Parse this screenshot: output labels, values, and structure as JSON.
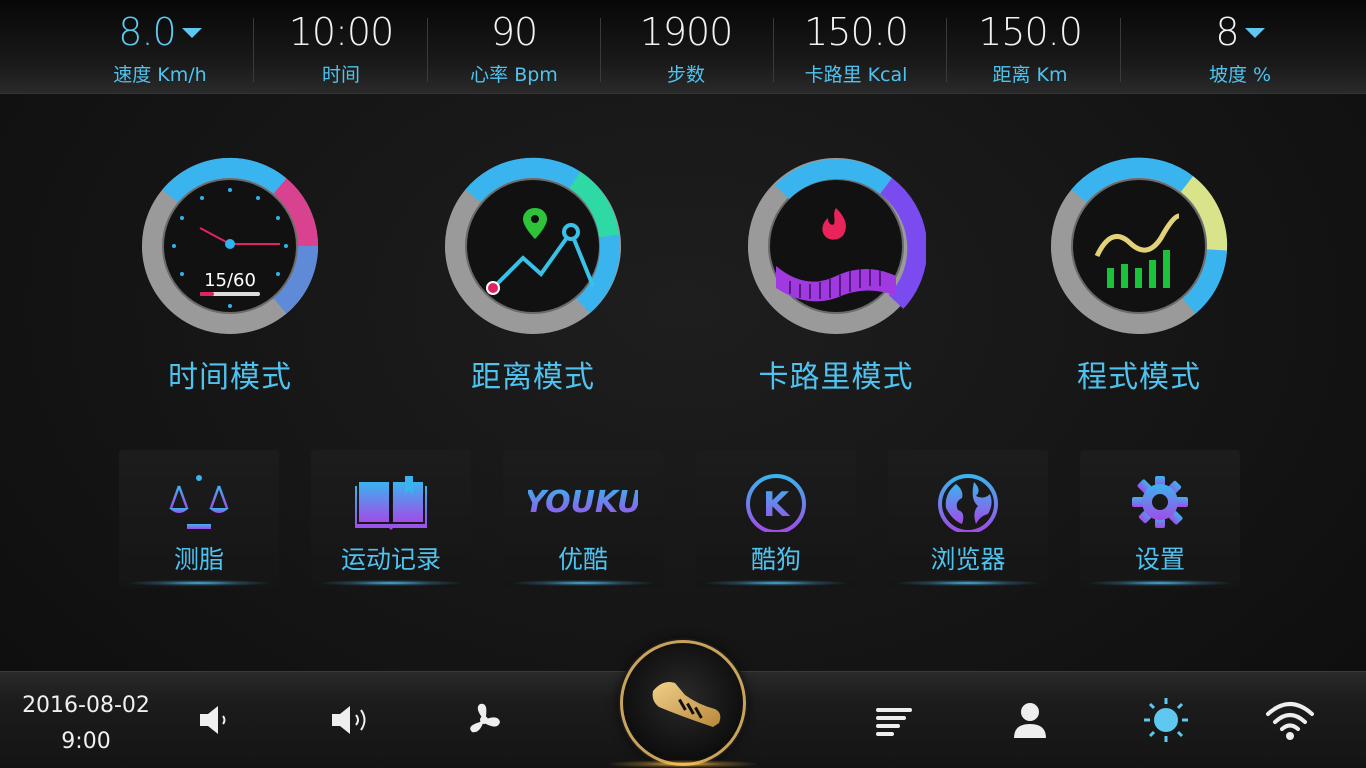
{
  "stats": [
    {
      "value": "8.0",
      "label": "速度 Km/h",
      "dropdown": true
    },
    {
      "value": "10:00",
      "label": "时间"
    },
    {
      "value": "90",
      "label": "心率 Bpm"
    },
    {
      "value": "1900",
      "label": "步数"
    },
    {
      "value": "150.0",
      "label": "卡路里 Kcal"
    },
    {
      "value": "150.0",
      "label": "距离 Km"
    },
    {
      "value": "8",
      "label": "坡度 %",
      "dropdown": true
    }
  ],
  "modes": [
    {
      "label": "时间模式",
      "icon": "clock-icon",
      "readout": "15/60"
    },
    {
      "label": "距离模式",
      "icon": "route-map-icon"
    },
    {
      "label": "卡路里模式",
      "icon": "flame-icon"
    },
    {
      "label": "程式模式",
      "icon": "program-chart-icon"
    }
  ],
  "apps": [
    {
      "label": "测脂",
      "icon": "scale-icon"
    },
    {
      "label": "运动记录",
      "icon": "book-icon"
    },
    {
      "label": "优酷",
      "icon": "youku-logo",
      "logo_text": "YOUKU"
    },
    {
      "label": "酷狗",
      "icon": "kugou-logo",
      "logo_text": "K"
    },
    {
      "label": "浏览器",
      "icon": "globe-icon"
    },
    {
      "label": "设置",
      "icon": "gear-icon"
    }
  ],
  "bottom": {
    "date": "2016-08-02",
    "time": "9:00",
    "icons": [
      "volume-down-icon",
      "volume-up-icon",
      "fan-icon",
      "running-shoe-icon",
      "menu-icon",
      "user-icon",
      "brightness-icon",
      "wifi-icon"
    ]
  },
  "colors": {
    "accent": "#4fc3f0",
    "gold": "#c9a35a",
    "background": "#141414"
  }
}
